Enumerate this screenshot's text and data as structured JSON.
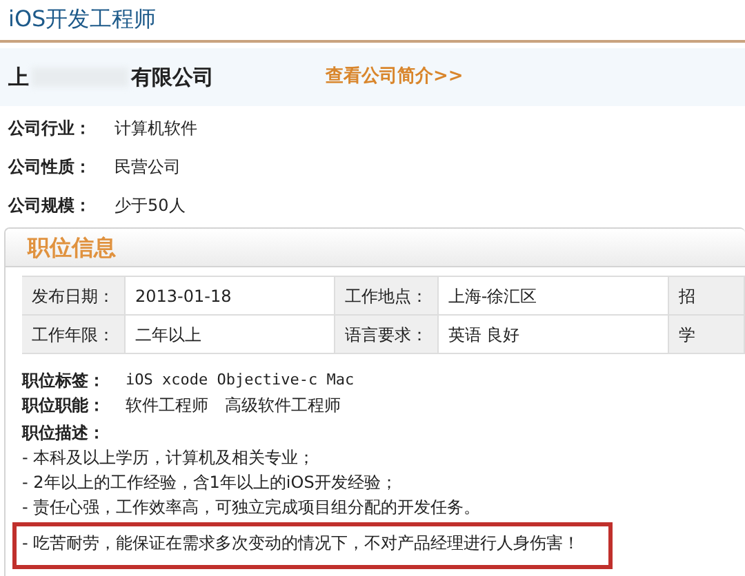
{
  "page_title": "iOS开发工程师",
  "company": {
    "name_start": "上",
    "name_end": "有限公司",
    "link": "查看公司简介>>"
  },
  "company_facts": [
    {
      "label": "公司行业：",
      "value": "计算机软件"
    },
    {
      "label": "公司性质：",
      "value": "民营公司"
    },
    {
      "label": "公司规模：",
      "value": "少于50人"
    }
  ],
  "section": {
    "title": "职位信息",
    "table_rows": [
      [
        "发布日期：",
        "2013-01-18",
        "工作地点：",
        "上海-徐汇区",
        "招"
      ],
      [
        "工作年限：",
        "二年以上",
        "语言要求：",
        "英语 良好",
        "学"
      ]
    ],
    "tags": {
      "label": "职位标签：",
      "value": "iOS xcode Objective-c Mac"
    },
    "functions": {
      "label": "职位职能：",
      "value": "软件工程师　高级软件工程师"
    },
    "description": {
      "label": "职位描述：",
      "items": [
        {
          "text": "- 本科及以上学历，计算机及相关专业；",
          "highlighted": false
        },
        {
          "text": "- 2年以上的工作经验，含1年以上的iOS开发经验；",
          "highlighted": false
        },
        {
          "text": "- 责任心强，工作效率高，可独立完成项目组分配的开发任务。",
          "highlighted": false
        },
        {
          "text": "- 吃苦耐劳，能保证在需求多次变动的情况下，不对产品经理进行人身伤害！",
          "highlighted": true
        }
      ]
    }
  }
}
